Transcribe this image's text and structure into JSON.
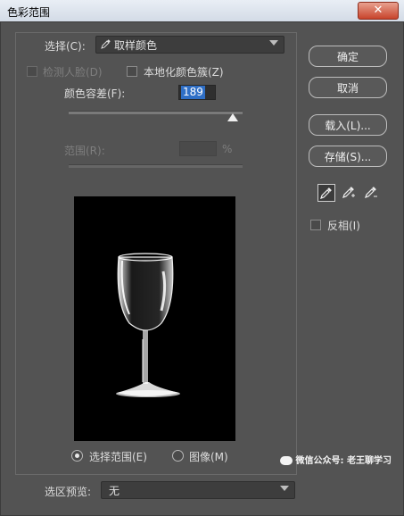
{
  "window": {
    "title": "色彩范围",
    "close_glyph": "✕"
  },
  "select": {
    "label": "选择(C):",
    "value": "取样颜色",
    "icon": "eyedropper-icon"
  },
  "options": {
    "detect_faces": "检测人脸(D)",
    "localized_clusters": "本地化颜色簇(Z)"
  },
  "fuzziness": {
    "label": "颜色容差(F):",
    "value": "189"
  },
  "range": {
    "label": "范围(R):",
    "unit": "%"
  },
  "preview_mode": {
    "selection": "选择范围(E)",
    "image": "图像(M)",
    "selected": "selection"
  },
  "buttons": {
    "ok": "确定",
    "cancel": "取消",
    "load": "载入(L)...",
    "save": "存储(S)..."
  },
  "invert": {
    "label": "反相(I)"
  },
  "selection_preview": {
    "label": "选区预览:",
    "value": "无"
  },
  "watermark": "微信公众号: 老王聊学习",
  "colors": {
    "panel": "#535353",
    "accent": "#2f6fc6"
  }
}
